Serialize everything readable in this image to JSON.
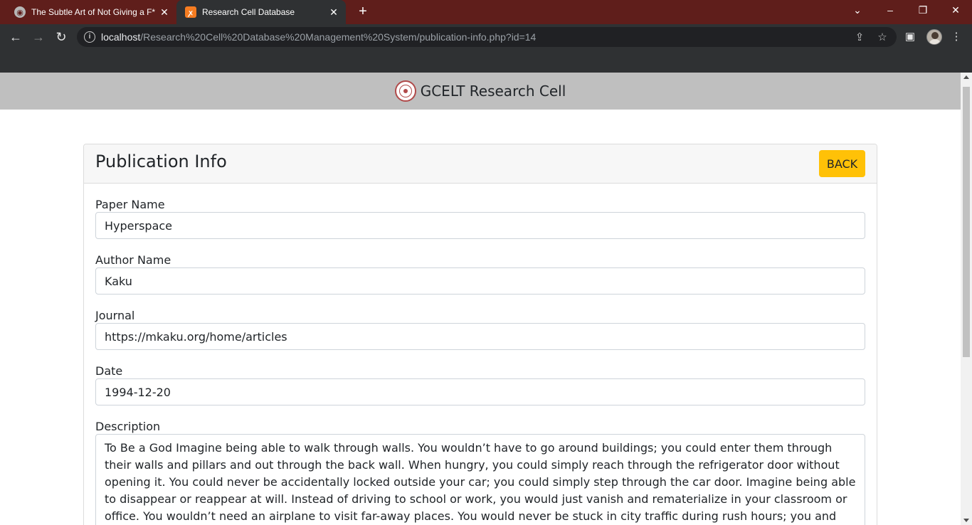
{
  "browser": {
    "tabs": [
      {
        "title": "The Subtle Art of Not Giving a F*",
        "active": false,
        "icon": "globe-icon"
      },
      {
        "title": "Research Cell Database",
        "active": true,
        "icon": "xampp-icon"
      }
    ],
    "url_host": "localhost",
    "url_path": "/Research%20Cell%20Database%20Management%20System/publication-info.php?id=14"
  },
  "site": {
    "title": "GCELT Research Cell"
  },
  "card": {
    "title": "Publication Info",
    "back_label": "BACK"
  },
  "fields": {
    "paper_name": {
      "label": "Paper Name",
      "value": "Hyperspace"
    },
    "author_name": {
      "label": "Author Name",
      "value": "Kaku"
    },
    "journal": {
      "label": "Journal",
      "value": "https://mkaku.org/home/articles"
    },
    "date": {
      "label": "Date",
      "value": "1994-12-20"
    },
    "description": {
      "label": "Description",
      "value": "To Be a God Imagine being able to walk through walls. You wouldn’t have to go around buildings; you could enter them through their walls and pillars and out through the back wall. When hungry, you could simply reach through the refrigerator door without opening it. You could never be accidentally locked outside your car; you could simply step through the car door. Imagine being able to disappear or reappear at will. Instead of driving to school or work, you would just vanish and rematerialize in your classroom or office. You wouldn’t need an airplane to visit far-away places. You would never be stuck in city traffic during rush hours; you and your car would simply disappear and rematerialize at your destination. Imagine"
    }
  },
  "colors": {
    "tabstrip": "#5f1e1b",
    "toolbar": "#2f3133",
    "site_header": "#bfbfbf",
    "back_button": "#ffc107"
  }
}
